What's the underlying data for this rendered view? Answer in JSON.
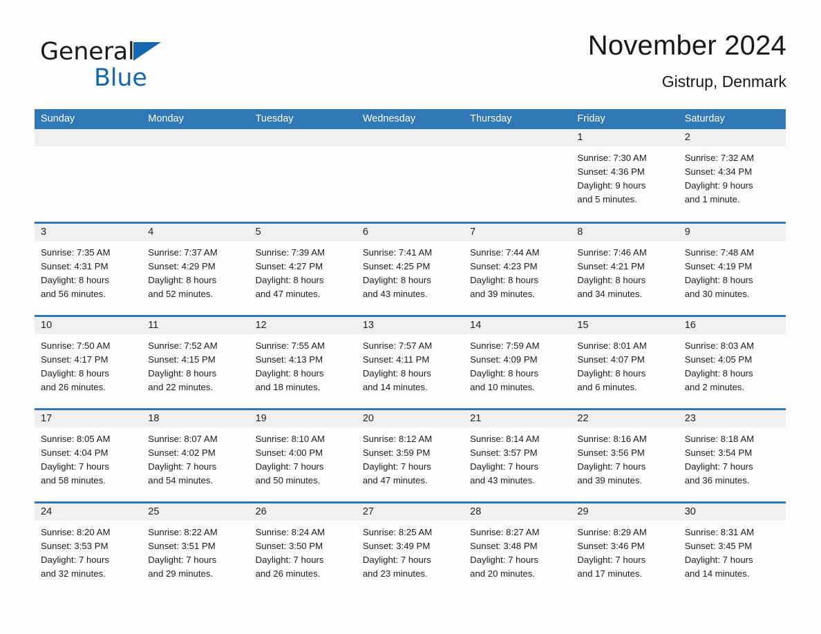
{
  "brand": {
    "word1": "General",
    "word2": "Blue",
    "triangle_color": "#1567b0",
    "icon": "triangle-logo"
  },
  "header": {
    "title": "November 2024",
    "subtitle": "Gistrup, Denmark"
  },
  "theme": {
    "header_blue": "#2f77b5",
    "daynum_gray": "#f0f0f0",
    "page_bg": "#fdfdfd",
    "text": "#1c1c1c"
  },
  "weekdays": [
    "Sunday",
    "Monday",
    "Tuesday",
    "Wednesday",
    "Thursday",
    "Friday",
    "Saturday"
  ],
  "labels": {
    "sunrise": "Sunrise:",
    "sunset": "Sunset:",
    "daylight": "Daylight:"
  },
  "weeks": [
    [
      {
        "day": "",
        "empty": true
      },
      {
        "day": "",
        "empty": true
      },
      {
        "day": "",
        "empty": true
      },
      {
        "day": "",
        "empty": true
      },
      {
        "day": "",
        "empty": true
      },
      {
        "day": "1",
        "sunrise": "Sunrise: 7:30 AM",
        "sunset": "Sunset: 4:36 PM",
        "daylight1": "Daylight: 9 hours",
        "daylight2": "and 5 minutes."
      },
      {
        "day": "2",
        "sunrise": "Sunrise: 7:32 AM",
        "sunset": "Sunset: 4:34 PM",
        "daylight1": "Daylight: 9 hours",
        "daylight2": "and 1 minute."
      }
    ],
    [
      {
        "day": "3",
        "sunrise": "Sunrise: 7:35 AM",
        "sunset": "Sunset: 4:31 PM",
        "daylight1": "Daylight: 8 hours",
        "daylight2": "and 56 minutes."
      },
      {
        "day": "4",
        "sunrise": "Sunrise: 7:37 AM",
        "sunset": "Sunset: 4:29 PM",
        "daylight1": "Daylight: 8 hours",
        "daylight2": "and 52 minutes."
      },
      {
        "day": "5",
        "sunrise": "Sunrise: 7:39 AM",
        "sunset": "Sunset: 4:27 PM",
        "daylight1": "Daylight: 8 hours",
        "daylight2": "and 47 minutes."
      },
      {
        "day": "6",
        "sunrise": "Sunrise: 7:41 AM",
        "sunset": "Sunset: 4:25 PM",
        "daylight1": "Daylight: 8 hours",
        "daylight2": "and 43 minutes."
      },
      {
        "day": "7",
        "sunrise": "Sunrise: 7:44 AM",
        "sunset": "Sunset: 4:23 PM",
        "daylight1": "Daylight: 8 hours",
        "daylight2": "and 39 minutes."
      },
      {
        "day": "8",
        "sunrise": "Sunrise: 7:46 AM",
        "sunset": "Sunset: 4:21 PM",
        "daylight1": "Daylight: 8 hours",
        "daylight2": "and 34 minutes."
      },
      {
        "day": "9",
        "sunrise": "Sunrise: 7:48 AM",
        "sunset": "Sunset: 4:19 PM",
        "daylight1": "Daylight: 8 hours",
        "daylight2": "and 30 minutes."
      }
    ],
    [
      {
        "day": "10",
        "sunrise": "Sunrise: 7:50 AM",
        "sunset": "Sunset: 4:17 PM",
        "daylight1": "Daylight: 8 hours",
        "daylight2": "and 26 minutes."
      },
      {
        "day": "11",
        "sunrise": "Sunrise: 7:52 AM",
        "sunset": "Sunset: 4:15 PM",
        "daylight1": "Daylight: 8 hours",
        "daylight2": "and 22 minutes."
      },
      {
        "day": "12",
        "sunrise": "Sunrise: 7:55 AM",
        "sunset": "Sunset: 4:13 PM",
        "daylight1": "Daylight: 8 hours",
        "daylight2": "and 18 minutes."
      },
      {
        "day": "13",
        "sunrise": "Sunrise: 7:57 AM",
        "sunset": "Sunset: 4:11 PM",
        "daylight1": "Daylight: 8 hours",
        "daylight2": "and 14 minutes."
      },
      {
        "day": "14",
        "sunrise": "Sunrise: 7:59 AM",
        "sunset": "Sunset: 4:09 PM",
        "daylight1": "Daylight: 8 hours",
        "daylight2": "and 10 minutes."
      },
      {
        "day": "15",
        "sunrise": "Sunrise: 8:01 AM",
        "sunset": "Sunset: 4:07 PM",
        "daylight1": "Daylight: 8 hours",
        "daylight2": "and 6 minutes."
      },
      {
        "day": "16",
        "sunrise": "Sunrise: 8:03 AM",
        "sunset": "Sunset: 4:05 PM",
        "daylight1": "Daylight: 8 hours",
        "daylight2": "and 2 minutes."
      }
    ],
    [
      {
        "day": "17",
        "sunrise": "Sunrise: 8:05 AM",
        "sunset": "Sunset: 4:04 PM",
        "daylight1": "Daylight: 7 hours",
        "daylight2": "and 58 minutes."
      },
      {
        "day": "18",
        "sunrise": "Sunrise: 8:07 AM",
        "sunset": "Sunset: 4:02 PM",
        "daylight1": "Daylight: 7 hours",
        "daylight2": "and 54 minutes."
      },
      {
        "day": "19",
        "sunrise": "Sunrise: 8:10 AM",
        "sunset": "Sunset: 4:00 PM",
        "daylight1": "Daylight: 7 hours",
        "daylight2": "and 50 minutes."
      },
      {
        "day": "20",
        "sunrise": "Sunrise: 8:12 AM",
        "sunset": "Sunset: 3:59 PM",
        "daylight1": "Daylight: 7 hours",
        "daylight2": "and 47 minutes."
      },
      {
        "day": "21",
        "sunrise": "Sunrise: 8:14 AM",
        "sunset": "Sunset: 3:57 PM",
        "daylight1": "Daylight: 7 hours",
        "daylight2": "and 43 minutes."
      },
      {
        "day": "22",
        "sunrise": "Sunrise: 8:16 AM",
        "sunset": "Sunset: 3:56 PM",
        "daylight1": "Daylight: 7 hours",
        "daylight2": "and 39 minutes."
      },
      {
        "day": "23",
        "sunrise": "Sunrise: 8:18 AM",
        "sunset": "Sunset: 3:54 PM",
        "daylight1": "Daylight: 7 hours",
        "daylight2": "and 36 minutes."
      }
    ],
    [
      {
        "day": "24",
        "sunrise": "Sunrise: 8:20 AM",
        "sunset": "Sunset: 3:53 PM",
        "daylight1": "Daylight: 7 hours",
        "daylight2": "and 32 minutes."
      },
      {
        "day": "25",
        "sunrise": "Sunrise: 8:22 AM",
        "sunset": "Sunset: 3:51 PM",
        "daylight1": "Daylight: 7 hours",
        "daylight2": "and 29 minutes."
      },
      {
        "day": "26",
        "sunrise": "Sunrise: 8:24 AM",
        "sunset": "Sunset: 3:50 PM",
        "daylight1": "Daylight: 7 hours",
        "daylight2": "and 26 minutes."
      },
      {
        "day": "27",
        "sunrise": "Sunrise: 8:25 AM",
        "sunset": "Sunset: 3:49 PM",
        "daylight1": "Daylight: 7 hours",
        "daylight2": "and 23 minutes."
      },
      {
        "day": "28",
        "sunrise": "Sunrise: 8:27 AM",
        "sunset": "Sunset: 3:48 PM",
        "daylight1": "Daylight: 7 hours",
        "daylight2": "and 20 minutes."
      },
      {
        "day": "29",
        "sunrise": "Sunrise: 8:29 AM",
        "sunset": "Sunset: 3:46 PM",
        "daylight1": "Daylight: 7 hours",
        "daylight2": "and 17 minutes."
      },
      {
        "day": "30",
        "sunrise": "Sunrise: 8:31 AM",
        "sunset": "Sunset: 3:45 PM",
        "daylight1": "Daylight: 7 hours",
        "daylight2": "and 14 minutes."
      }
    ]
  ]
}
